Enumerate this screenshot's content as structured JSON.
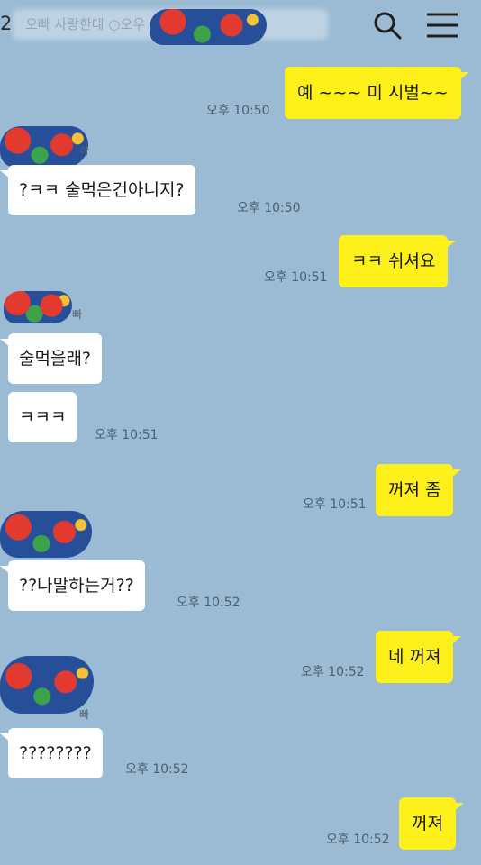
{
  "header": {
    "unread_count": "2",
    "title": "오빠 사랑한데 ○오우 ○ ⊙가수",
    "icons": [
      "search-icon",
      "menu-icon"
    ]
  },
  "messages": [
    {
      "side": "me",
      "text": "예 ~~~ 미 시벌~~",
      "time": "오후 10:50"
    },
    {
      "side": "other",
      "text": "?ㅋㅋ 술먹은건아니지?",
      "time": "오후 10:50"
    },
    {
      "side": "me",
      "text": "ㅋㅋ 쉬셔요",
      "time": "오후 10:51"
    },
    {
      "side": "other",
      "sender": "빠",
      "text": "술먹을래?",
      "time": ""
    },
    {
      "side": "other",
      "text": "ㅋㅋㅋ",
      "time": "오후 10:51"
    },
    {
      "side": "me",
      "text": "꺼져 좀",
      "time": "오후 10:51"
    },
    {
      "side": "other",
      "text": "??나말하는거??",
      "time": "오후 10:52"
    },
    {
      "side": "me",
      "text": "네 꺼져",
      "time": "오후 10:52"
    },
    {
      "side": "other",
      "text": "????????",
      "time": "오후 10:52"
    },
    {
      "side": "me",
      "text": "꺼져",
      "time": "오후 10:52"
    }
  ],
  "senders": {
    "first": "하",
    "second": "빠",
    "fourth": "빠"
  },
  "colors": {
    "background": "#9bbbd4",
    "my_bubble": "#fef01b",
    "other_bubble": "#ffffff"
  }
}
